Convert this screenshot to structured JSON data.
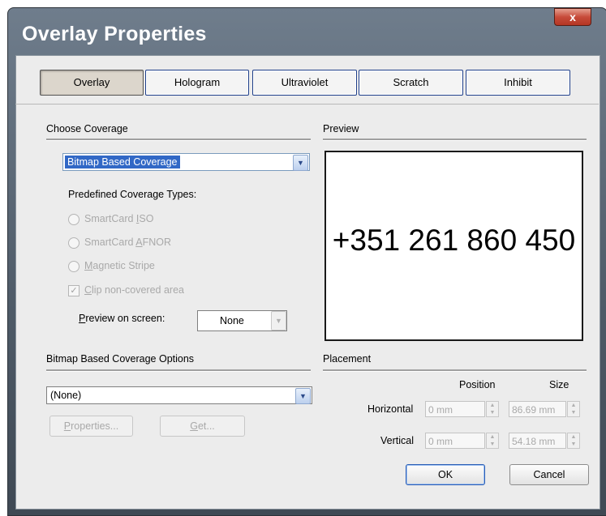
{
  "window": {
    "title": "Overlay Properties",
    "close_label": "x"
  },
  "tabs": [
    {
      "label": "Overlay",
      "active": true
    },
    {
      "label": "Hologram",
      "active": false
    },
    {
      "label": "Ultraviolet",
      "active": false
    },
    {
      "label": "Scratch",
      "active": false
    },
    {
      "label": "Inhibit",
      "active": false
    }
  ],
  "coverage": {
    "header": "Choose Coverage",
    "selected_type": "Bitmap Based Coverage",
    "predefined_label": "Predefined Coverage Types:",
    "options": [
      {
        "label": "SmartCard ISO",
        "pre": "SmartCard ",
        "key": "I",
        "post": "SO"
      },
      {
        "label": "SmartCard AFNOR",
        "pre": "SmartCard ",
        "key": "A",
        "post": "FNOR"
      },
      {
        "label": "Magnetic Stripe",
        "pre": "",
        "key": "M",
        "post": "agnetic Stripe"
      }
    ],
    "clip_label": {
      "pre": "",
      "key": "C",
      "post": "lip non-covered area"
    },
    "clip_checked": true,
    "preview_on_screen": {
      "pre": "",
      "key": "P",
      "post": "review on screen:"
    },
    "preview_on_screen_value": "None"
  },
  "preview": {
    "header": "Preview",
    "text": "+351 261 860 450"
  },
  "bitmap_options": {
    "header": "Bitmap Based Coverage Options",
    "selected": "(None)",
    "properties_button": {
      "pre": "",
      "key": "P",
      "post": "roperties..."
    },
    "get_button": {
      "pre": "",
      "key": "G",
      "post": "et..."
    }
  },
  "placement": {
    "header": "Placement",
    "position_label": "Position",
    "size_label": "Size",
    "horizontal_label": "Horizontal",
    "vertical_label": "Vertical",
    "horizontal_position": "0 mm",
    "horizontal_size": "86.69 mm",
    "vertical_position": "0 mm",
    "vertical_size": "54.18 mm"
  },
  "buttons": {
    "ok": "OK",
    "cancel": "Cancel"
  }
}
